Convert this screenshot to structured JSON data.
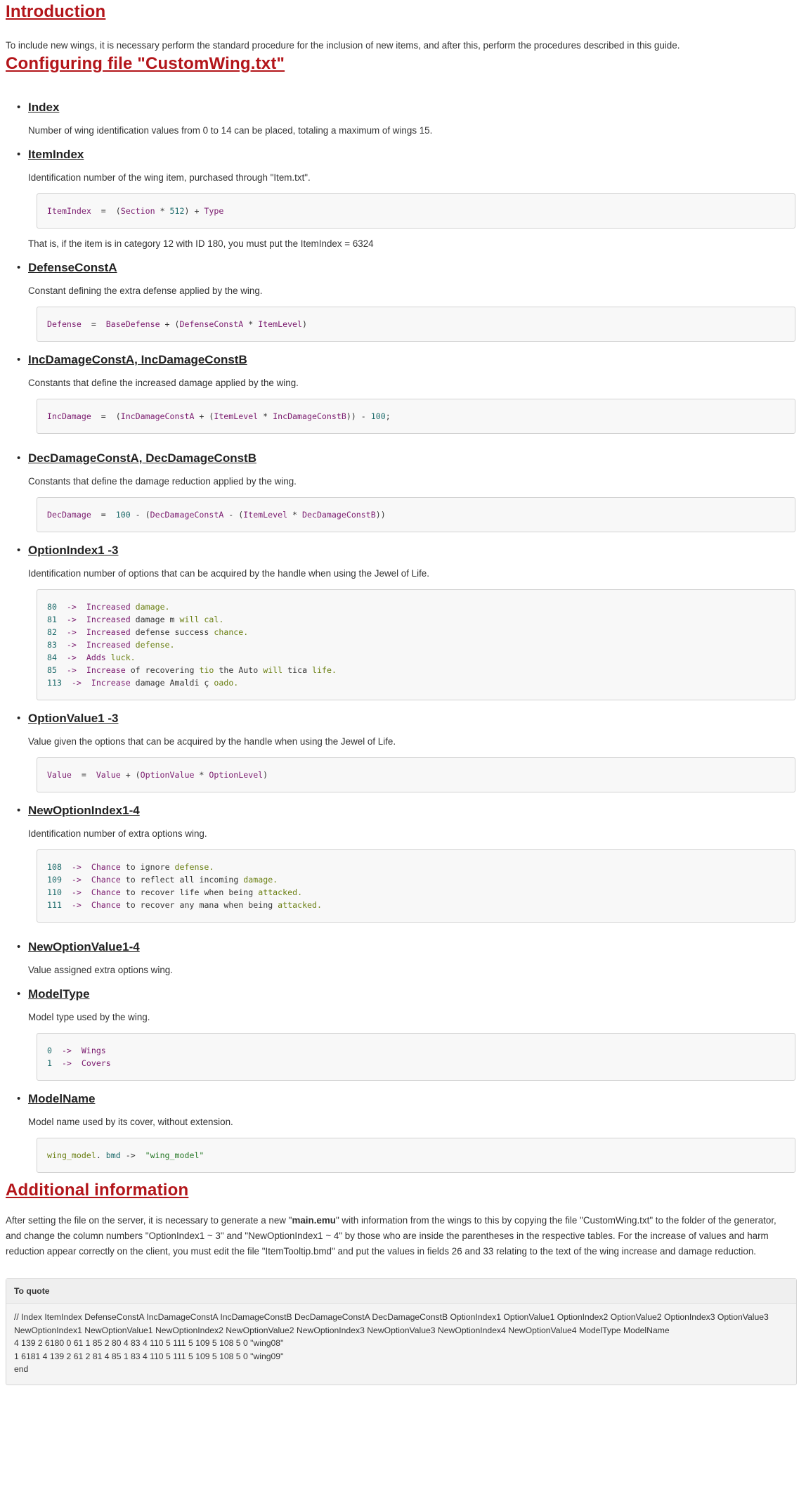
{
  "intro": {
    "title": "Introduction",
    "text": "To include new wings, it is necessary perform the standard procedure for the inclusion of new items, and after this, perform the procedures described in this guide."
  },
  "config": {
    "title": "Configuring file \"CustomWing.txt\"",
    "items": [
      {
        "title": "Index",
        "desc": "Number of wing identification values from 0 to 14 can be placed, totaling a maximum of wings 15."
      },
      {
        "title": "ItemIndex",
        "desc": "Identification number of the wing item, purchased through \"Item.txt\".",
        "code": [
          "ItemIndex  =  (Section * 512) + Type"
        ],
        "note": "That is, if the item is in category 12 with ID 180, you must put the ItemIndex = 6324"
      },
      {
        "title": "DefenseConstA",
        "desc": "Constant defining the extra defense applied by the wing.",
        "code": [
          "Defense  =  BaseDefense + (DefenseConstA * ItemLevel)"
        ]
      },
      {
        "title": "IncDamageConstA, IncDamageConstB",
        "desc": "Constants that define the increased damage applied by the wing.",
        "code": [
          "IncDamage  =  (IncDamageConstA + (ItemLevel * IncDamageConstB)) - 100;"
        ]
      },
      {
        "title": "DecDamageConstA, DecDamageConstB",
        "desc": "Constants that define the damage reduction applied by the wing.",
        "code": [
          "DecDamage  =  100 - (DecDamageConstA - (ItemLevel * DecDamageConstB))"
        ]
      },
      {
        "title": "OptionIndex1 -3",
        "desc": "Identification number of options that can be acquired by the handle when using the Jewel of Life.",
        "code": [
          "80  ->  Increased damage.",
          "81  ->  Increased damage m will cal.",
          "82  ->  Increased defense success chance.",
          "83  ->  Increased defense.",
          "84  ->  Adds luck.",
          "85  ->  Increase of recovering tio the Auto will tica life.",
          "113  ->  Increase damage Amaldi ç oado."
        ]
      },
      {
        "title": "OptionValue1 -3",
        "desc": "Value given the options that can be acquired by the handle when using the Jewel of Life.",
        "code": [
          "Value  =  Value + (OptionValue * OptionLevel)"
        ]
      },
      {
        "title": "NewOptionIndex1-4",
        "desc": "Identification number of extra options wing.",
        "code": [
          "108  ->  Chance to ignore defense.",
          "109  ->  Chance to reflect all incoming damage.",
          "110  ->  Chance to recover life when being attacked.",
          "111  ->  Chance to recover any mana when being attacked."
        ]
      },
      {
        "title": "NewOptionValue1-4",
        "desc": "Value assigned extra options wing."
      },
      {
        "title": "ModelType",
        "desc": "Model type used by the wing.",
        "code": [
          "0  ->  Wings",
          "1  ->  Covers"
        ]
      },
      {
        "title": "ModelName",
        "desc": "Model name used by its cover, without extension.",
        "code": [
          "wing_model. bmd ->  \"wing_model\""
        ]
      }
    ]
  },
  "additional": {
    "title": "Additional information",
    "text_a": "After setting the file on the server, it is necessary to generate a new \"",
    "text_bold": "main.emu",
    "text_b": "\" with information from the wings to this by copying the file \"CustomWing.txt\" to the folder of the generator, and change the column numbers \"OptionIndex1 ~ 3\" and \"NewOptionIndex1 ~ 4\" by those who are inside the parentheses in the respective tables. For the increase of values and harm reduction appear correctly on the client, you must edit the file \"ItemTooltip.bmd\" and put the values in fields 26 and 33 relating to the text of the wing increase and damage reduction."
  },
  "quote": {
    "header": "To quote",
    "lines": [
      "// Index ItemIndex DefenseConstA IncDamageConstA IncDamageConstB DecDamageConstA DecDamageConstB OptionIndex1 OptionValue1 OptionIndex2 OptionValue2 OptionIndex3 OptionValue3 NewOptionIndex1 NewOptionValue1 NewOptionIndex2 NewOptionValue2 NewOptionIndex3 NewOptionValue3 NewOptionIndex4 NewOptionValue4 ModelType ModelName",
      "4 139 2 6180 0 61 1 85 2 80 4 83 4 110 5 111 5 109 5 108 5 0 \"wing08\"",
      "1 6181 4 139 2 61 2 81 4 85 1 83 4 110 5 111 5 109 5 108 5 0 \"wing09\"",
      "end"
    ]
  },
  "colors": {
    "heading": "#b3151a",
    "code_bg": "#f8f8f8",
    "quote_bg": "#f4f4f4"
  }
}
